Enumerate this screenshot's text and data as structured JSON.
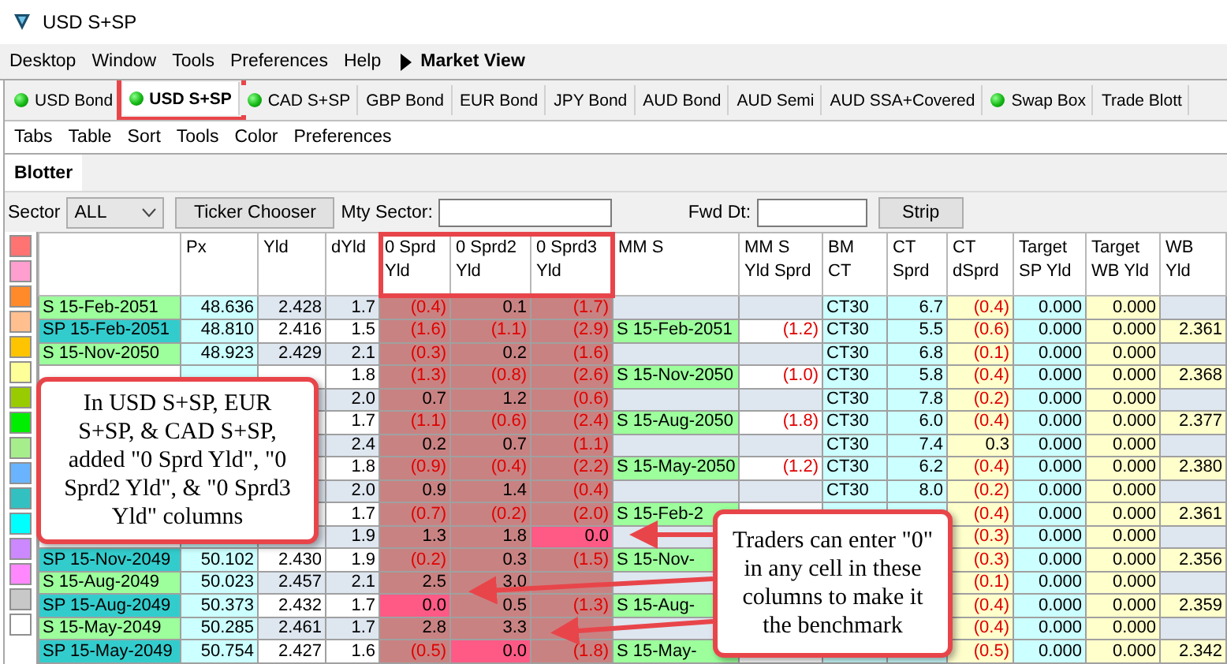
{
  "window": {
    "title": "USD S+SP"
  },
  "menu": [
    "Desktop",
    "Window",
    "Tools",
    "Preferences",
    "Help"
  ],
  "menu_section": "Market View",
  "tabs": [
    {
      "label": "USD Bond",
      "dot": true,
      "selected": false,
      "highlighted": false
    },
    {
      "label": "USD S+SP",
      "dot": true,
      "selected": true,
      "highlighted": true
    },
    {
      "label": "CAD S+SP",
      "dot": true,
      "selected": false,
      "highlighted": false
    },
    {
      "label": "GBP Bond",
      "dot": false,
      "selected": false,
      "highlighted": false
    },
    {
      "label": "EUR Bond",
      "dot": false,
      "selected": false,
      "highlighted": false
    },
    {
      "label": "JPY Bond",
      "dot": false,
      "selected": false,
      "highlighted": false
    },
    {
      "label": "AUD Bond",
      "dot": false,
      "selected": false,
      "highlighted": false
    },
    {
      "label": "AUD Semi",
      "dot": false,
      "selected": false,
      "highlighted": false
    },
    {
      "label": "AUD SSA+Covered",
      "dot": false,
      "selected": false,
      "highlighted": false
    },
    {
      "label": "Swap Box",
      "dot": true,
      "selected": false,
      "highlighted": false
    },
    {
      "label": "Trade Blott",
      "dot": false,
      "selected": false,
      "highlighted": false
    }
  ],
  "submenu": [
    "Tabs",
    "Table",
    "Sort",
    "Tools",
    "Color",
    "Preferences"
  ],
  "panel_tabs": [
    {
      "label": "Blotter",
      "selected": true
    }
  ],
  "filters": {
    "sector_label": "Sector",
    "sector_value": "ALL",
    "ticker_button": "Ticker Chooser",
    "mty_label": "Mty Sector:",
    "fwd_label": "Fwd Dt:",
    "strip_button": "Strip"
  },
  "swatches": [
    {
      "color": "#ff7373"
    },
    {
      "color": "#ff9fcf"
    },
    {
      "color": "#ff8a2a"
    },
    {
      "color": "#ffbf8f"
    },
    {
      "color": "#ffc400"
    },
    {
      "color": "#ffff99"
    },
    {
      "color": "#99cc00"
    },
    {
      "color": "#00ee00"
    },
    {
      "color": "#a6ee8c"
    },
    {
      "color": "#6ab4ff"
    },
    {
      "color": "#33c0c0"
    },
    {
      "color": "#00ffff"
    },
    {
      "color": "#cc88ff"
    },
    {
      "color": "#ff88ff"
    },
    {
      "color": "#c8c8c8"
    },
    {
      "color": "#ffffff"
    }
  ],
  "table": {
    "columns": [
      {
        "kind": "security"
      },
      {
        "label": "Px",
        "kind": "price"
      },
      {
        "label": "Yld",
        "kind": "yield"
      },
      {
        "label": "dYld",
        "kind": "yield"
      },
      {
        "label": "0 Sprd\nYld",
        "kind": "zero-spread",
        "highlighted": true
      },
      {
        "label": "0 Sprd2\nYld",
        "kind": "zero-spread",
        "highlighted": true
      },
      {
        "label": "0 Sprd3\nYld",
        "kind": "zero-spread",
        "highlighted": true
      },
      {
        "label": "MM S",
        "kind": "ref-security"
      },
      {
        "label": "MM S\nYld Sprd",
        "kind": "yield"
      },
      {
        "label": "BM\nCT",
        "kind": "price"
      },
      {
        "label": "CT\nSprd",
        "kind": "price"
      },
      {
        "label": "CT\ndSprd",
        "kind": "target"
      },
      {
        "label": "Target\nSP Yld",
        "kind": "price"
      },
      {
        "label": "Target\nWB Yld",
        "kind": "target"
      },
      {
        "label": "WB\nYld",
        "kind": "optional-target"
      }
    ],
    "rows": [
      {
        "kind": "s",
        "cells": [
          "S 15-Feb-2051",
          "48.636",
          "2.428",
          "1.7",
          {
            "text": "(0.4)",
            "negative": true
          },
          "0.1",
          {
            "text": "(1.7)",
            "negative": true
          },
          null,
          null,
          "CT30",
          "6.7",
          {
            "text": "(0.4)",
            "negative": true
          },
          "0.000",
          "0.000",
          null
        ]
      },
      {
        "kind": "sp",
        "cells": [
          "SP 15-Feb-2051",
          "48.810",
          "2.416",
          "1.5",
          {
            "text": "(1.6)",
            "negative": true
          },
          {
            "text": "(1.1)",
            "negative": true
          },
          {
            "text": "(2.9)",
            "negative": true
          },
          "S 15-Feb-2051",
          {
            "text": "(1.2)",
            "negative": true
          },
          "CT30",
          "5.5",
          {
            "text": "(0.6)",
            "negative": true
          },
          "0.000",
          "0.000",
          "2.361"
        ]
      },
      {
        "kind": "s",
        "cells": [
          "S 15-Nov-2050",
          "48.923",
          "2.429",
          "2.1",
          {
            "text": "(0.3)",
            "negative": true
          },
          "0.2",
          {
            "text": "(1.6)",
            "negative": true
          },
          null,
          null,
          "CT30",
          "6.8",
          {
            "text": "(0.1)",
            "negative": true
          },
          "0.000",
          "0.000",
          null
        ]
      },
      {
        "cells": [
          null,
          null,
          null,
          "1.8",
          {
            "text": "(1.3)",
            "negative": true
          },
          {
            "text": "(0.8)",
            "negative": true
          },
          {
            "text": "(2.6)",
            "negative": true
          },
          "S 15-Nov-2050",
          {
            "text": "(1.0)",
            "negative": true
          },
          "CT30",
          "5.8",
          {
            "text": "(0.4)",
            "negative": true
          },
          "0.000",
          "0.000",
          "2.368"
        ]
      },
      {
        "cells": [
          null,
          null,
          null,
          "2.0",
          "0.7",
          "1.2",
          {
            "text": "(0.6)",
            "negative": true
          },
          null,
          null,
          "CT30",
          "7.8",
          {
            "text": "(0.2)",
            "negative": true
          },
          "0.000",
          "0.000",
          null
        ]
      },
      {
        "cells": [
          null,
          null,
          null,
          "1.7",
          {
            "text": "(1.1)",
            "negative": true
          },
          {
            "text": "(0.6)",
            "negative": true
          },
          {
            "text": "(2.4)",
            "negative": true
          },
          "S 15-Aug-2050",
          {
            "text": "(1.8)",
            "negative": true
          },
          "CT30",
          "6.0",
          {
            "text": "(0.4)",
            "negative": true
          },
          "0.000",
          "0.000",
          "2.377"
        ]
      },
      {
        "cells": [
          null,
          null,
          null,
          "2.4",
          "0.2",
          "0.7",
          {
            "text": "(1.1)",
            "negative": true
          },
          null,
          null,
          "CT30",
          "7.4",
          "0.3",
          "0.000",
          "0.000",
          null
        ]
      },
      {
        "cells": [
          null,
          null,
          null,
          "1.8",
          {
            "text": "(0.9)",
            "negative": true
          },
          {
            "text": "(0.4)",
            "negative": true
          },
          {
            "text": "(2.2)",
            "negative": true
          },
          "S 15-May-2050",
          {
            "text": "(1.2)",
            "negative": true
          },
          "CT30",
          "6.2",
          {
            "text": "(0.4)",
            "negative": true
          },
          "0.000",
          "0.000",
          "2.380"
        ]
      },
      {
        "cells": [
          null,
          null,
          null,
          "2.0",
          "0.9",
          "1.4",
          {
            "text": "(0.4)",
            "negative": true
          },
          null,
          null,
          "CT30",
          "8.0",
          {
            "text": "(0.2)",
            "negative": true
          },
          "0.000",
          "0.000",
          null
        ]
      },
      {
        "cells": [
          null,
          null,
          null,
          "1.7",
          {
            "text": "(0.7)",
            "negative": true
          },
          {
            "text": "(0.2)",
            "negative": true
          },
          {
            "text": "(2.0)",
            "negative": true
          },
          "S 15-Feb-2",
          null,
          null,
          null,
          {
            "text": "(0.4)",
            "negative": true
          },
          "0.000",
          "0.000",
          "2.361"
        ]
      },
      {
        "cells": [
          null,
          null,
          null,
          "1.9",
          "1.3",
          "1.8",
          {
            "text": "0.0",
            "benchmark": true
          },
          null,
          null,
          null,
          null,
          {
            "text": "(0.3)",
            "negative": true
          },
          "0.000",
          "0.000",
          null
        ]
      },
      {
        "kind": "sp",
        "cells": [
          "SP 15-Nov-2049",
          "50.102",
          "2.430",
          "1.9",
          {
            "text": "(0.2)",
            "negative": true
          },
          "0.3",
          {
            "text": "(1.5)",
            "negative": true
          },
          "S 15-Nov-",
          null,
          null,
          null,
          {
            "text": "(0.3)",
            "negative": true
          },
          "0.000",
          "0.000",
          "2.356"
        ]
      },
      {
        "kind": "s",
        "cells": [
          "S 15-Aug-2049",
          "50.023",
          "2.457",
          "2.1",
          "2.5",
          "3.0",
          null,
          null,
          null,
          null,
          null,
          {
            "text": "(0.1)",
            "negative": true
          },
          "0.000",
          "0.000",
          null
        ]
      },
      {
        "kind": "sp",
        "cells": [
          "SP 15-Aug-2049",
          "50.373",
          "2.432",
          "1.7",
          {
            "text": "0.0",
            "benchmark": true
          },
          "0.5",
          {
            "text": "(1.3)",
            "negative": true
          },
          "S 15-Aug-",
          null,
          null,
          null,
          {
            "text": "(0.4)",
            "negative": true
          },
          "0.000",
          "0.000",
          "2.359"
        ]
      },
      {
        "kind": "s",
        "cells": [
          "S 15-May-2049",
          "50.285",
          "2.461",
          "1.7",
          "2.8",
          "3.3",
          null,
          null,
          null,
          null,
          null,
          {
            "text": "(0.4)",
            "negative": true
          },
          "0.000",
          "0.000",
          null
        ]
      },
      {
        "kind": "sp",
        "cells": [
          "SP 15-May-2049",
          "50.754",
          "2.427",
          "1.6",
          {
            "text": "(0.5)",
            "negative": true
          },
          {
            "text": "0.0",
            "benchmark": true
          },
          {
            "text": "(1.8)",
            "negative": true
          },
          "S 15-May-",
          null,
          null,
          null,
          {
            "text": "(0.5)",
            "negative": true
          },
          "0.000",
          "0.000",
          "2.342"
        ]
      }
    ]
  },
  "callouts": [
    {
      "text": "In USD S+SP, EUR S+SP, & CAD S+SP, added \"0 Sprd Yld\", \"0 Sprd2 Yld\", & \"0 Sprd3 Yld\" columns",
      "kind": "left"
    },
    {
      "text": "Traders can enter \"0\" in any cell in these columns to make it the benchmark",
      "kind": "right"
    }
  ]
}
